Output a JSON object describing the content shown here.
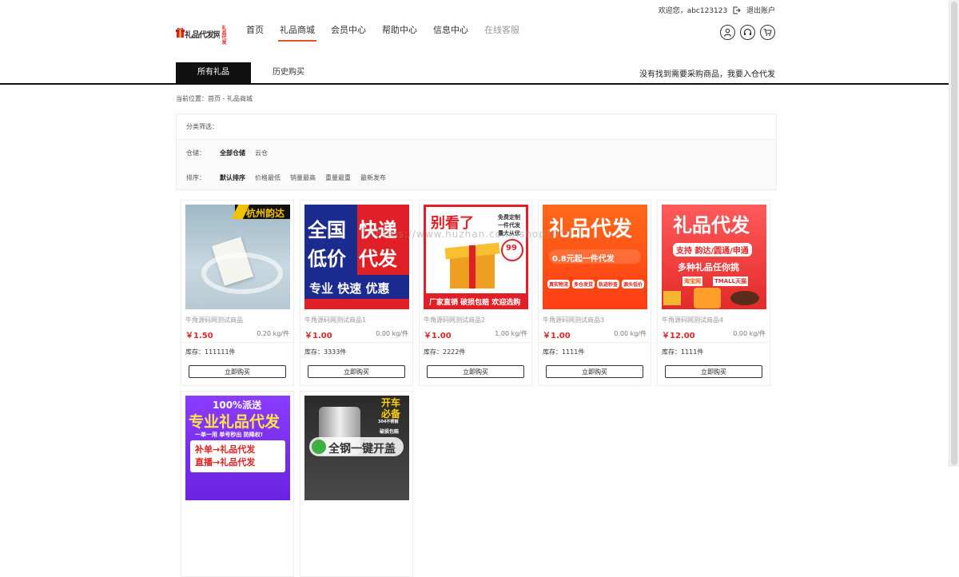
{
  "topbar": {
    "welcome": "欢迎您，abc123123",
    "logout": "退出账户"
  },
  "logo": {
    "text": "礼品代发网",
    "stamp": "礼品代发"
  },
  "nav": {
    "items": [
      {
        "label": "首页"
      },
      {
        "label": "礼品商城"
      },
      {
        "label": "会员中心"
      },
      {
        "label": "帮助中心"
      },
      {
        "label": "信息中心"
      },
      {
        "label": "在线客服"
      }
    ],
    "active_index": 1
  },
  "tabs": {
    "items": [
      {
        "label": "所有礼品"
      },
      {
        "label": "历史购买"
      }
    ],
    "right_link": "没有找到需要采购商品，我要入仓代发"
  },
  "breadcrumb": "当前位置：首页 - 礼品商城",
  "filter": {
    "title": "分类筛选：",
    "warehouse_label": "仓储：",
    "warehouse_options": [
      "全部仓储",
      "云仓"
    ],
    "sort_label": "排序：",
    "sort_options": [
      "默认排序",
      "价格最低",
      "销量最高",
      "重量最重",
      "最新发布"
    ]
  },
  "watermark": "https://www.huzhan.com/ishop1009",
  "products": [
    {
      "name": "牛角源码网测试商品",
      "price": "￥1.50",
      "weight": "0.20 kg/件",
      "stock": "库存：111111件",
      "buy": "立即购买",
      "img_text": [
        "杭州韵达"
      ]
    },
    {
      "name": "牛角源码网测试商品1",
      "price": "￥1.00",
      "weight": "0.00 kg/件",
      "stock": "库存：3333件",
      "buy": "立即购买",
      "img_text": [
        "全国",
        "快递",
        "低价",
        "代发",
        "专业 快速 优惠"
      ]
    },
    {
      "name": "牛角源码网测试商品2",
      "price": "￥1.00",
      "weight": "1.00 kg/件",
      "stock": "库存：2222件",
      "buy": "立即购买",
      "img_text": [
        "别看了",
        "免费定制",
        "一件代发",
        "量大从优",
        "99",
        "厂家直销 破损包赔 欢迎选购"
      ]
    },
    {
      "name": "牛角源码网测试商品3",
      "price": "￥1.00",
      "weight": "0.00 kg/件",
      "stock": "库存：1111件",
      "buy": "立即购买",
      "img_text": [
        "礼品代发",
        "0.8元起一件代发",
        "真实物流",
        "多仓发货",
        "轨迹秒查",
        "源头低价"
      ]
    },
    {
      "name": "牛角源码网测试商品4",
      "price": "￥12.00",
      "weight": "0.00 kg/件",
      "stock": "库存：1111件",
      "buy": "立即购买",
      "img_text": [
        "礼品代发",
        "支持 韵达/圆通/申通",
        "多种礼品任你挑",
        "淘宝网",
        "TMALL天猫"
      ]
    },
    {
      "name": "",
      "price": "",
      "weight": "",
      "stock": "",
      "buy": "",
      "img_text": [
        "100%派送",
        "专业礼品代发",
        "一单一用 单号秒出 防降权!",
        "补单→礼品代发",
        "直播→礼品代发"
      ]
    },
    {
      "name": "",
      "price": "",
      "weight": "",
      "stock": "",
      "buy": "",
      "img_text": [
        "开车",
        "必备",
        "304不锈钢",
        "破损包赔",
        "全钢一键开盖"
      ]
    }
  ],
  "colors": {
    "accent": "#e8542a",
    "price": "#e02525",
    "tab_active": "#111111"
  }
}
